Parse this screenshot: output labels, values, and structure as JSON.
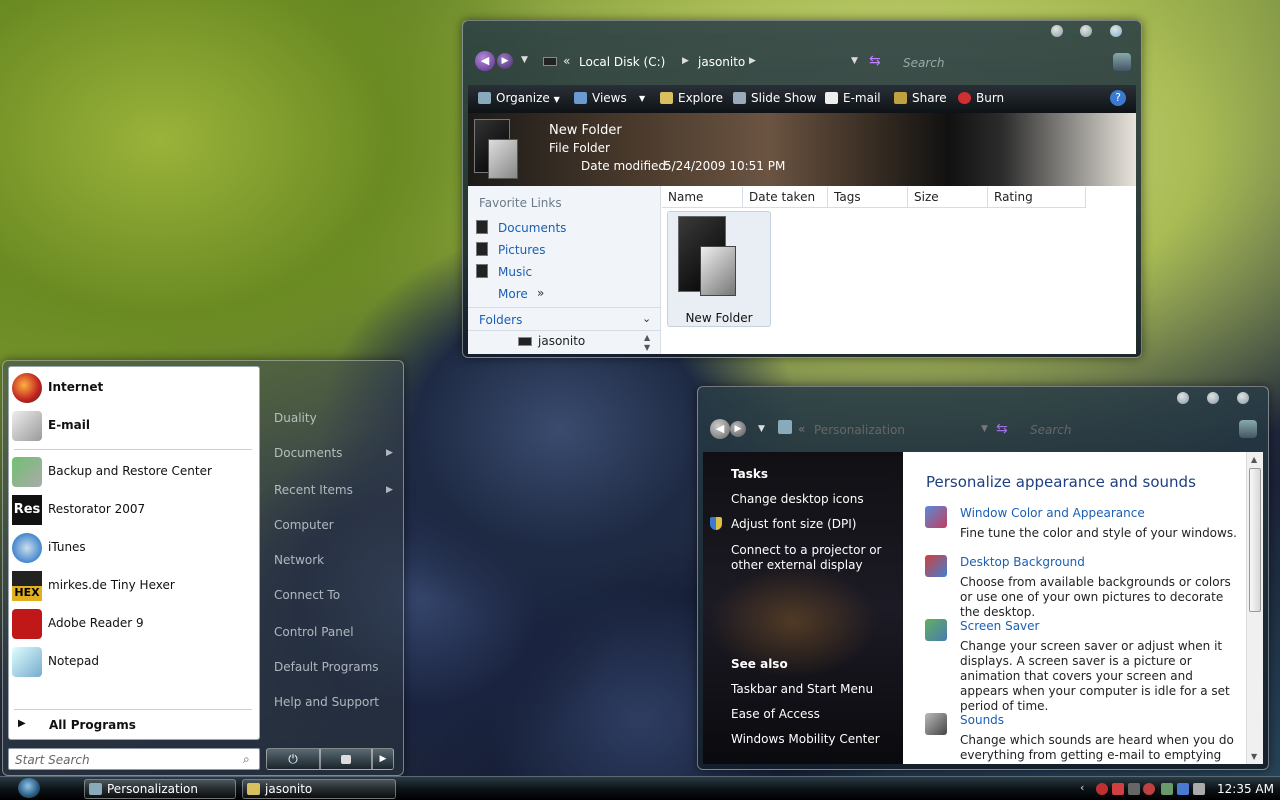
{
  "explorer": {
    "breadcrumb": [
      "Local Disk (C:)",
      "jasonito"
    ],
    "search_placeholder": "Search",
    "toolbar": [
      "Organize",
      "Views",
      "Explore",
      "Slide Show",
      "E-mail",
      "Share",
      "Burn"
    ],
    "details": {
      "name": "New Folder",
      "type": "File Folder",
      "date_label": "Date modified:",
      "date_value": "5/24/2009 10:51 PM"
    },
    "favorite_links_title": "Favorite Links",
    "favorite_links": [
      "Documents",
      "Pictures",
      "Music",
      "More"
    ],
    "folders_label": "Folders",
    "folder_tree_item": "jasonito",
    "columns": [
      "Name",
      "Date taken",
      "Tags",
      "Size",
      "Rating"
    ],
    "item_label": "New Folder"
  },
  "control_panel": {
    "breadcrumb": "Personalization",
    "search_placeholder": "Search",
    "tasks_title": "Tasks",
    "tasks": [
      "Change desktop icons",
      "Adjust font size (DPI)",
      "Connect to a projector or other external display"
    ],
    "see_also_title": "See also",
    "see_also": [
      "Taskbar and Start Menu",
      "Ease of Access",
      "Windows Mobility Center"
    ],
    "heading": "Personalize appearance and sounds",
    "items": [
      {
        "title": "Window Color and Appearance",
        "desc": "Fine tune the color and style of your windows."
      },
      {
        "title": "Desktop Background",
        "desc": "Choose from available backgrounds or colors or use one of your own pictures to decorate the desktop."
      },
      {
        "title": "Screen Saver",
        "desc": "Change your screen saver or adjust when it displays. A screen saver is a picture or animation that covers your screen and appears when your computer is idle for a set period of time."
      },
      {
        "title": "Sounds",
        "desc": "Change which sounds are heard when you do everything from getting e-mail to emptying your"
      }
    ]
  },
  "start_menu": {
    "pinned": [
      "Internet",
      "E-mail"
    ],
    "recent": [
      "Backup and Restore Center",
      "Restorator 2007",
      "iTunes",
      "mirkes.de Tiny Hexer",
      "Adobe Reader 9",
      "Notepad"
    ],
    "all_programs": "All Programs",
    "search_placeholder": "Start Search",
    "right": [
      "Duality",
      "Documents",
      "Recent Items",
      "Computer",
      "Network",
      "Connect To",
      "Control Panel",
      "Default Programs",
      "Help and Support"
    ]
  },
  "taskbar": {
    "tasks": [
      "Personalization",
      "jasonito"
    ],
    "clock": "12:35 AM"
  }
}
